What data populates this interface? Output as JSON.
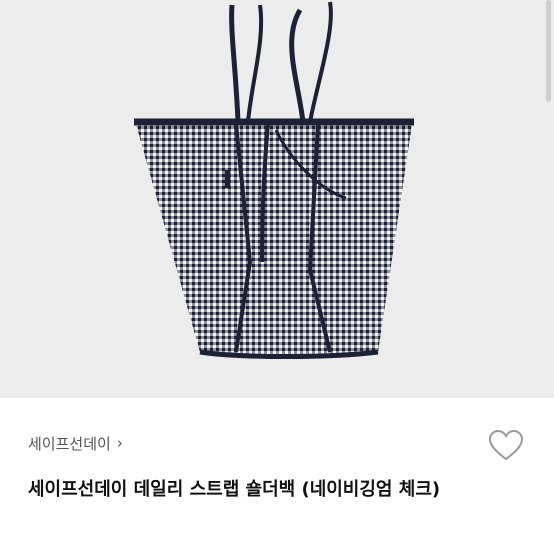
{
  "product": {
    "image_alt": "navy gingham tote bag",
    "brand": "세이프선데이",
    "title": "세이프선데이 데일리 스트랩 숄더백 (네이비깅엄 체크)"
  },
  "icons": {
    "brand_chevron": "chevron-right-icon",
    "wishlist": "heart-outline-icon"
  },
  "colors": {
    "navy": "#1c2136",
    "background_photo": "#ececec"
  }
}
